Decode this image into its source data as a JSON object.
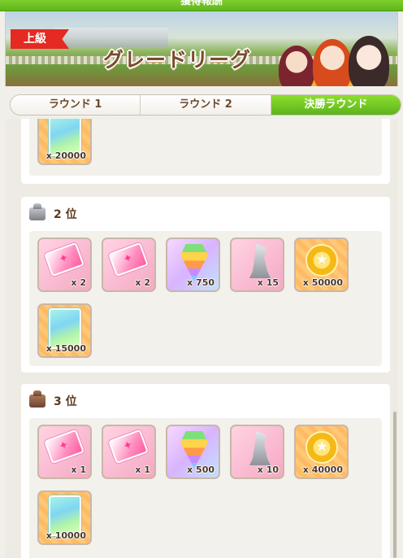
{
  "header": {
    "title": "獲得報酬"
  },
  "banner": {
    "grade": "上級",
    "league_name": "グレードリーグ"
  },
  "tabs": [
    {
      "label": "ラウンド 1",
      "active": false
    },
    {
      "label": "ラウンド 2",
      "active": false
    },
    {
      "label": "決勝ラウンド",
      "active": true
    }
  ],
  "ranks": [
    {
      "label": "",
      "items": [
        {
          "kind": "card-gem",
          "qty": "x 20000"
        }
      ]
    },
    {
      "label": "2 位",
      "trophy": "silver",
      "items": [
        {
          "kind": "ticket",
          "qty": "x 2"
        },
        {
          "kind": "ticket",
          "qty": "x 2"
        },
        {
          "kind": "carrot",
          "qty": "x 750"
        },
        {
          "kind": "statue",
          "qty": "x 15"
        },
        {
          "kind": "coin",
          "qty": "x 50000"
        },
        {
          "kind": "card-gem",
          "qty": "x 15000"
        }
      ]
    },
    {
      "label": "3 位",
      "trophy": "bronze",
      "items": [
        {
          "kind": "ticket",
          "qty": "x 1"
        },
        {
          "kind": "ticket",
          "qty": "x 1"
        },
        {
          "kind": "carrot",
          "qty": "x 500"
        },
        {
          "kind": "statue",
          "qty": "x 10"
        },
        {
          "kind": "coin",
          "qty": "x 40000"
        },
        {
          "kind": "card-gem",
          "qty": "x 10000"
        }
      ]
    }
  ]
}
